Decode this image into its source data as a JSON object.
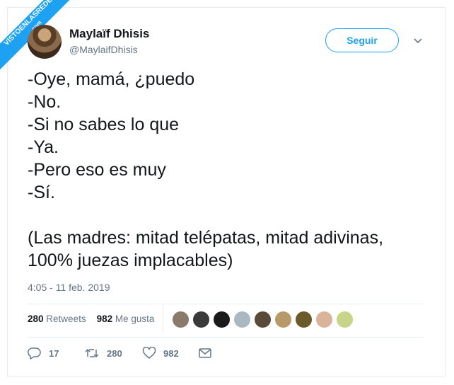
{
  "watermark": {
    "text": "VISTOENLASREDES",
    "sub": ".com"
  },
  "author": {
    "name": "Maylaïf Dhisis",
    "handle": "@MaylaifDhisis"
  },
  "follow_label": "Seguir",
  "tweet_lines": [
    "-Oye, mamá, ¿puedo",
    "-No.",
    "-Si no sabes lo que",
    "-Ya.",
    "-Pero eso es muy",
    "-Sí.",
    "(Las madres: mitad telépatas, mitad adivinas,",
    "100% juezas implacables)"
  ],
  "timestamp": "4:05 - 11 feb. 2019",
  "stats": {
    "retweets_count": "280",
    "retweets_label": "Retweets",
    "likes_count": "982",
    "likes_label": "Me gusta"
  },
  "liker_avatar_colors": [
    "#8a7a6a",
    "#3a3a3a",
    "#1a1a1a",
    "#aab8c2",
    "#5a4a3a",
    "#b89a6a",
    "#6b5a2a",
    "#d9b49a",
    "#c8d48a"
  ],
  "actions": {
    "replies": "17",
    "retweets": "280",
    "likes": "982"
  },
  "colors": {
    "accent": "#1da1f2",
    "secondary_text": "#657786",
    "primary_text": "#14171a",
    "border": "#e6ecf0"
  }
}
